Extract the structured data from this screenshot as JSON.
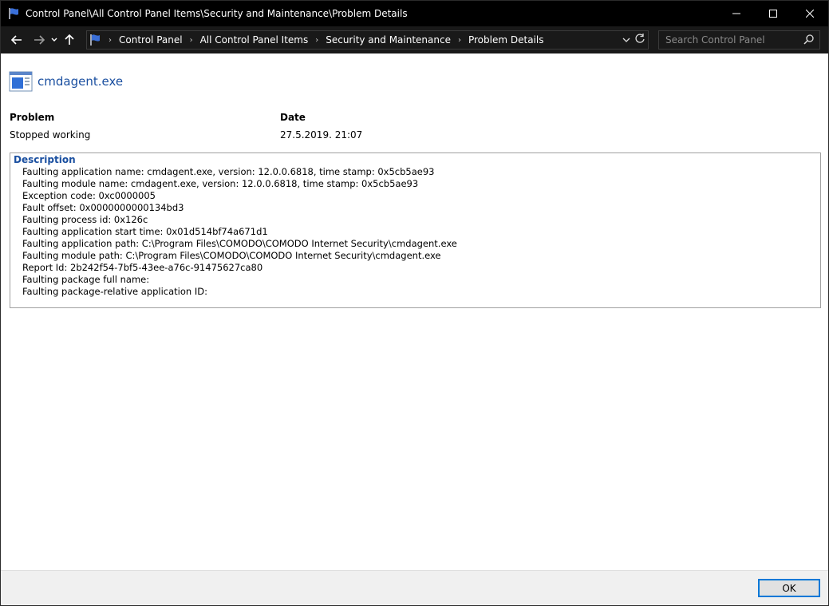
{
  "window": {
    "title": "Control Panel\\All Control Panel Items\\Security and Maintenance\\Problem Details"
  },
  "nav": {
    "breadcrumbs": [
      "Control Panel",
      "All Control Panel Items",
      "Security and Maintenance",
      "Problem Details"
    ],
    "search_placeholder": "Search Control Panel"
  },
  "app": {
    "name": "cmdagent.exe"
  },
  "details": {
    "problem_label": "Problem",
    "problem_value": "Stopped working",
    "date_label": "Date",
    "date_value": "27.5.2019. 21:07"
  },
  "description": {
    "title": "Description",
    "lines": [
      "Faulting application name: cmdagent.exe, version: 12.0.0.6818, time stamp: 0x5cb5ae93",
      "Faulting module name: cmdagent.exe, version: 12.0.0.6818, time stamp: 0x5cb5ae93",
      "Exception code: 0xc0000005",
      "Fault offset: 0x0000000000134bd3",
      "Faulting process id: 0x126c",
      "Faulting application start time: 0x01d514bf74a671d1",
      "Faulting application path: C:\\Program Files\\COMODO\\COMODO Internet Security\\cmdagent.exe",
      "Faulting module path: C:\\Program Files\\COMODO\\COMODO Internet Security\\cmdagent.exe",
      "Report Id: 2b242f54-7bf5-43ee-a76c-91475627ca80",
      "Faulting package full name: ",
      "Faulting package-relative application ID: "
    ]
  },
  "footer": {
    "ok_label": "OK"
  },
  "colors": {
    "accent": "#0078d7",
    "link_blue": "#1a4fa0",
    "titlebar": "#000000"
  }
}
